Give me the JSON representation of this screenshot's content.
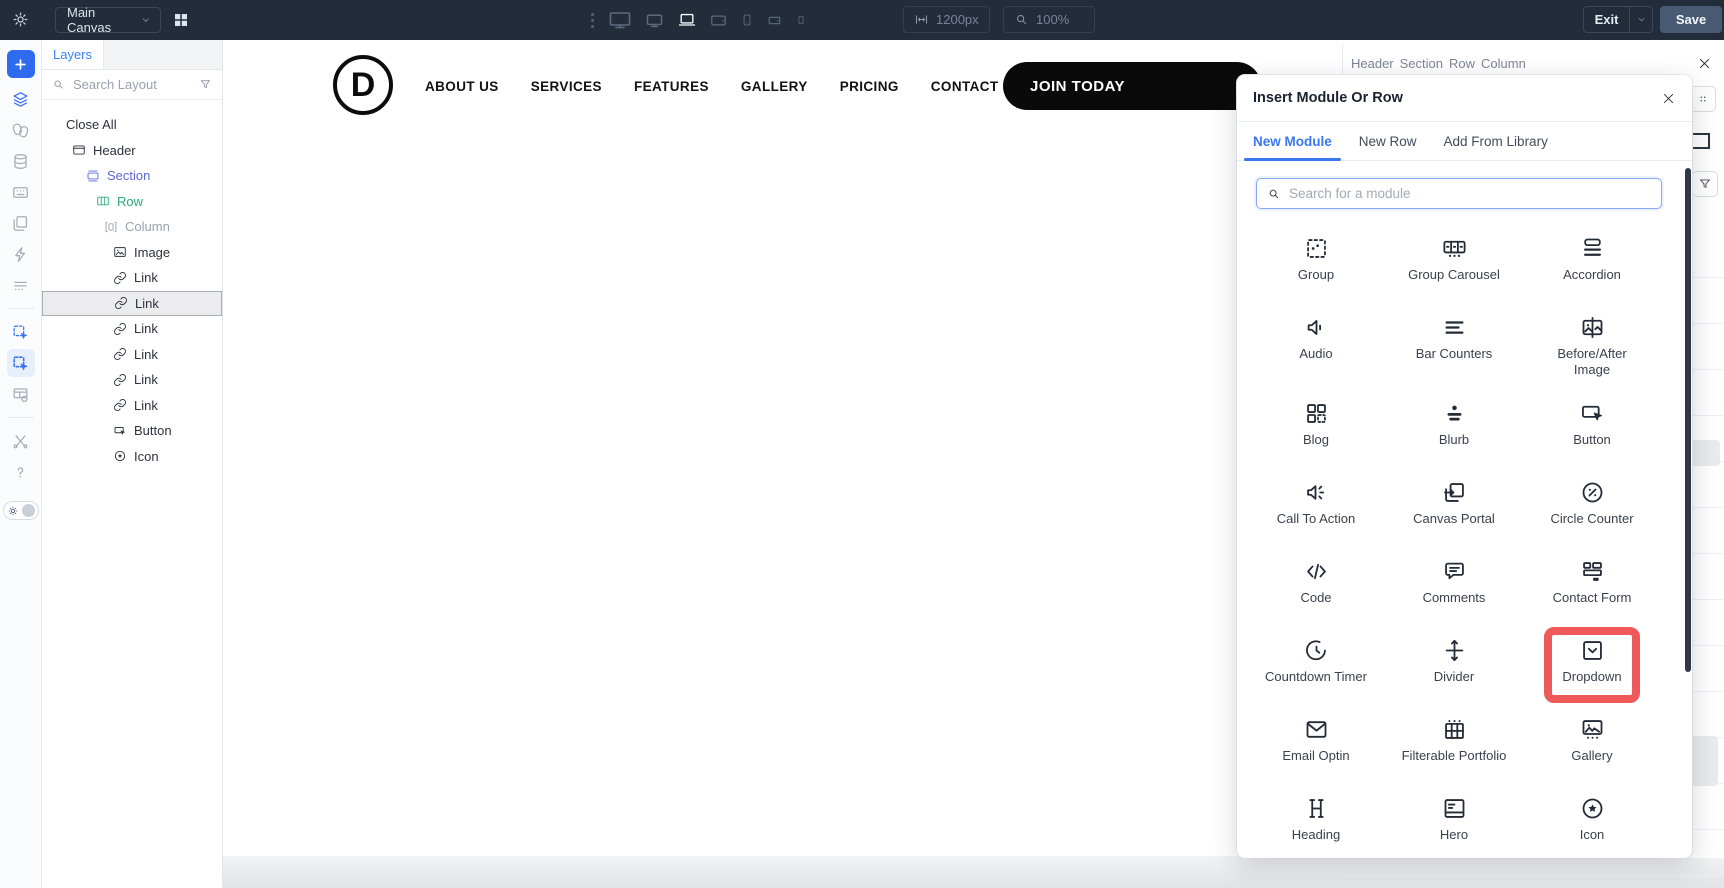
{
  "colors": {
    "accent_blue": "#3b76f1",
    "topbar_bg": "#222c3a",
    "save_button_bg": "#485a72",
    "highlight_red": "#ee5a5a",
    "section_blue": "#5a68d5",
    "row_green": "#2bab80",
    "column_gray": "#99a1ad"
  },
  "toolbar": {
    "canvas_select_value": "Main Canvas",
    "width_value": "1200px",
    "zoom_value": "100%",
    "exit_label": "Exit",
    "save_label": "Save",
    "devices": [
      {
        "icon": "desktop-large-icon",
        "cls": "w24"
      },
      {
        "icon": "desktop-icon",
        "cls": "w21"
      },
      {
        "icon": "laptop-icon",
        "cls": "w20 active"
      },
      {
        "icon": "tablet-landscape-icon",
        "cls": "w19"
      },
      {
        "icon": "phone-portrait-icon",
        "cls": "w14"
      },
      {
        "icon": "phone-landscape-icon",
        "cls": "w17"
      },
      {
        "icon": "phone-small-icon",
        "cls": "w12"
      }
    ]
  },
  "left_rail": {
    "items": [
      {
        "icon": "add-icon",
        "name": "add-button",
        "cls": "rail-add"
      },
      {
        "icon": "layers-icon",
        "name": "layers-button",
        "cls": "active-blue"
      },
      {
        "icon": "design-presets-icon",
        "name": "design-presets-button"
      },
      {
        "icon": "database-icon",
        "name": "database-button"
      },
      {
        "icon": "keyboard-icon",
        "name": "keyboard-shortcuts-button"
      },
      {
        "icon": "pages-icon",
        "name": "pages-button"
      },
      {
        "icon": "lightning-icon",
        "name": "quick-actions-button"
      },
      {
        "icon": "queue-icon",
        "name": "list-view-button"
      },
      {
        "divider": true
      },
      {
        "icon": "select-module-icon",
        "name": "select-module-button",
        "cls": "active-blue"
      },
      {
        "icon": "select-row-icon",
        "name": "select-row-button",
        "cls": "active-blue selected"
      },
      {
        "icon": "layout-settings-icon",
        "name": "layout-settings-button"
      },
      {
        "divider": true
      },
      {
        "icon": "tools-icon",
        "name": "tools-button"
      },
      {
        "icon": "help-icon",
        "name": "help-button"
      }
    ]
  },
  "layers_panel": {
    "tab_label": "Layers",
    "search_placeholder": "Search Layout",
    "close_all_label": "Close All",
    "tree": [
      {
        "label": "Header",
        "icon": "header-icon",
        "name": "layer-header",
        "cls": "d1"
      },
      {
        "label": "Section",
        "icon": "section-icon",
        "name": "layer-section",
        "cls": "d2 c-section"
      },
      {
        "label": "Row",
        "icon": "row-icon",
        "name": "layer-row",
        "cls": "d3 c-row"
      },
      {
        "label": "Column",
        "icon": "column-icon",
        "name": "layer-column",
        "cls": "d4 c-column"
      },
      {
        "label": "Image",
        "icon": "image-icon",
        "name": "layer-image",
        "cls": "d5"
      },
      {
        "label": "Link",
        "icon": "link-icon",
        "name": "layer-link",
        "cls": "d5"
      },
      {
        "label": "Link",
        "icon": "link-icon",
        "name": "layer-link-selected",
        "cls": "d5 selected-row"
      },
      {
        "label": "Link",
        "icon": "link-icon",
        "name": "layer-link",
        "cls": "d5"
      },
      {
        "label": "Link",
        "icon": "link-icon",
        "name": "layer-link",
        "cls": "d5"
      },
      {
        "label": "Link",
        "icon": "link-icon",
        "name": "layer-link",
        "cls": "d5"
      },
      {
        "label": "Link",
        "icon": "link-icon",
        "name": "layer-link",
        "cls": "d5"
      },
      {
        "label": "Button",
        "icon": "button-icon",
        "name": "layer-button",
        "cls": "d5"
      },
      {
        "label": "Icon",
        "icon": "icon-icon",
        "name": "layer-icon",
        "cls": "d5"
      }
    ]
  },
  "site_preview": {
    "logo_text": "D",
    "nav": [
      "ABOUT US",
      "SERVICES",
      "FEATURES",
      "GALLERY",
      "PRICING",
      "CONTACT"
    ],
    "cta_label": "JOIN TODAY"
  },
  "breadcrumb": {
    "items": [
      "Header",
      "Section",
      "Row",
      "Column"
    ],
    "separator": "›"
  },
  "modal": {
    "title": "Insert Module Or Row",
    "tabs": [
      {
        "label": "New Module",
        "name": "tab-new-module",
        "cls": "active"
      },
      {
        "label": "New Row",
        "name": "tab-new-row"
      },
      {
        "label": "Add From Library",
        "name": "tab-add-from-library"
      }
    ],
    "search_placeholder": "Search for a module",
    "modules": [
      {
        "label": "Group",
        "icon": "group-icon",
        "name": "module-group"
      },
      {
        "label": "Group Carousel",
        "icon": "group-carousel-icon",
        "name": "module-group-carousel"
      },
      {
        "label": "Accordion",
        "icon": "accordion-icon",
        "name": "module-accordion"
      },
      {
        "label": "Audio",
        "icon": "audio-icon",
        "name": "module-audio"
      },
      {
        "label": "Bar Counters",
        "icon": "bar-counters-icon",
        "name": "module-bar-counters"
      },
      {
        "label": "Before/After\nImage",
        "icon": "before-after-image-icon",
        "name": "module-before-after-image"
      },
      {
        "label": "Blog",
        "icon": "blog-icon",
        "name": "module-blog"
      },
      {
        "label": "Blurb",
        "icon": "blurb-icon",
        "name": "module-blurb"
      },
      {
        "label": "Button",
        "icon": "button-icon",
        "name": "module-button"
      },
      {
        "label": "Call To Action",
        "icon": "call-to-action-icon",
        "name": "module-call-to-action"
      },
      {
        "label": "Canvas Portal",
        "icon": "canvas-portal-icon",
        "name": "module-canvas-portal"
      },
      {
        "label": "Circle Counter",
        "icon": "circle-counter-icon",
        "name": "module-circle-counter"
      },
      {
        "label": "Code",
        "icon": "code-icon",
        "name": "module-code"
      },
      {
        "label": "Comments",
        "icon": "comments-icon",
        "name": "module-comments"
      },
      {
        "label": "Contact Form",
        "icon": "contact-form-icon",
        "name": "module-contact-form"
      },
      {
        "label": "Countdown Timer",
        "icon": "countdown-timer-icon",
        "name": "module-countdown-timer"
      },
      {
        "label": "Divider",
        "icon": "divider-icon",
        "name": "module-divider"
      },
      {
        "label": "Dropdown",
        "icon": "dropdown-icon",
        "name": "module-dropdown",
        "cls": "highlighted"
      },
      {
        "label": "Email Optin",
        "icon": "email-optin-icon",
        "name": "module-email-optin"
      },
      {
        "label": "Filterable Portfolio",
        "icon": "filterable-portfolio-icon",
        "name": "module-filterable-portfolio"
      },
      {
        "label": "Gallery",
        "icon": "gallery-icon",
        "name": "module-gallery"
      },
      {
        "label": "Heading",
        "icon": "heading-icon",
        "name": "module-heading"
      },
      {
        "label": "Hero",
        "icon": "hero-icon",
        "name": "module-hero"
      },
      {
        "label": "Icon",
        "icon": "icon-icon",
        "name": "module-icon"
      }
    ]
  }
}
